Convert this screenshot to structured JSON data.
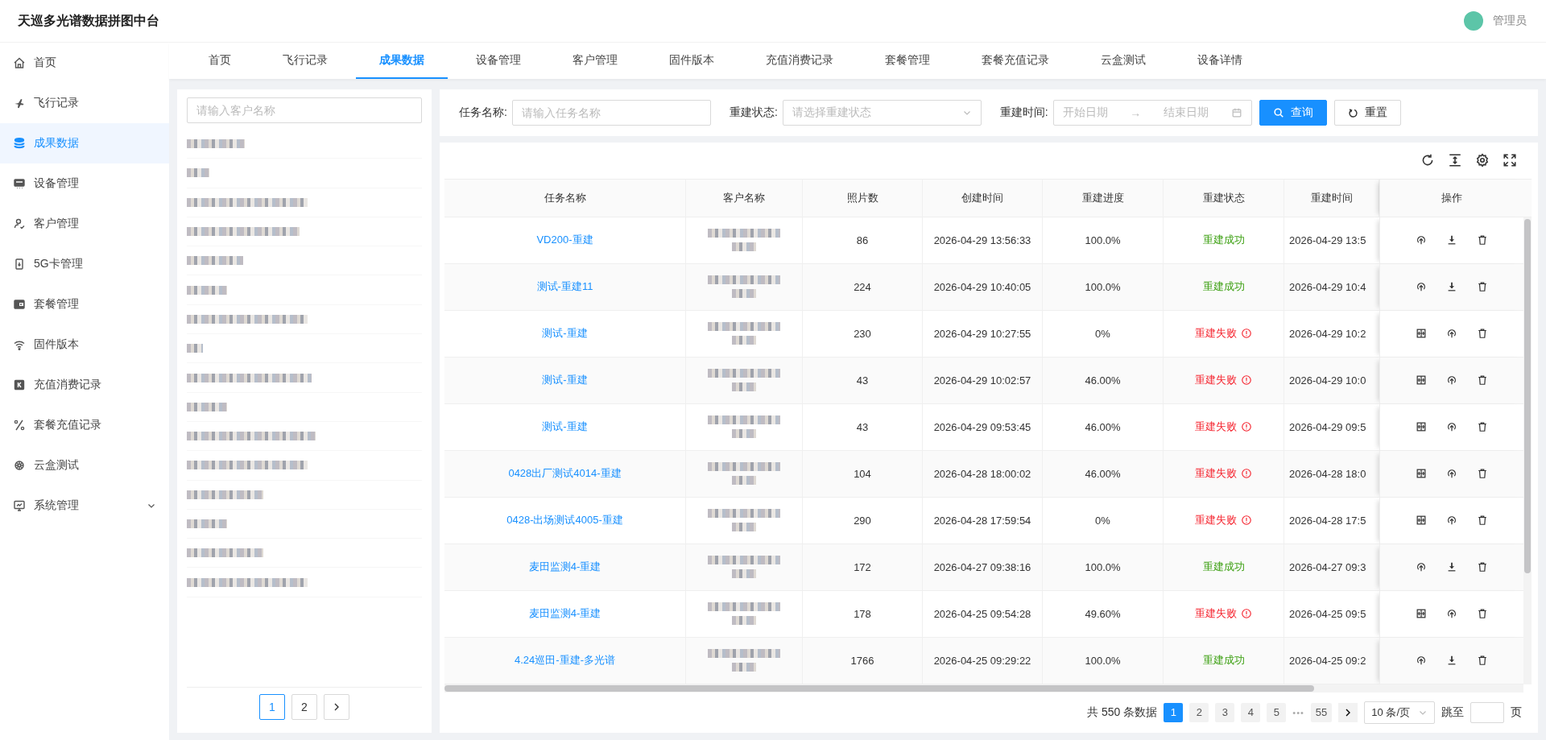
{
  "header": {
    "title": "天巡多光谱数据拼图中台",
    "user": "管理员"
  },
  "sidebar": {
    "items": [
      {
        "label": "首页",
        "kind": "link",
        "selected": false
      },
      {
        "label": "飞行记录",
        "kind": "link",
        "selected": false
      },
      {
        "label": "成果数据",
        "kind": "link",
        "selected": true
      },
      {
        "label": "设备管理",
        "kind": "link",
        "selected": false
      },
      {
        "label": "客户管理",
        "kind": "link",
        "selected": false
      },
      {
        "label": "5G卡管理",
        "kind": "link",
        "selected": false
      },
      {
        "label": "套餐管理",
        "kind": "link",
        "selected": false
      },
      {
        "label": "固件版本",
        "kind": "link",
        "selected": false
      },
      {
        "label": "充值消费记录",
        "kind": "link",
        "selected": false
      },
      {
        "label": "套餐充值记录",
        "kind": "link",
        "selected": false
      },
      {
        "label": "云盒测试",
        "kind": "link",
        "selected": false
      },
      {
        "label": "系统管理",
        "kind": "group",
        "selected": false,
        "expanded": false
      }
    ]
  },
  "tabs": [
    {
      "label": "首页",
      "selected": false
    },
    {
      "label": "飞行记录",
      "selected": false
    },
    {
      "label": "成果数据",
      "selected": true
    },
    {
      "label": "设备管理",
      "selected": false
    },
    {
      "label": "客户管理",
      "selected": false
    },
    {
      "label": "固件版本",
      "selected": false
    },
    {
      "label": "充值消费记录",
      "selected": false
    },
    {
      "label": "套餐管理",
      "selected": false
    },
    {
      "label": "套餐充值记录",
      "selected": false
    },
    {
      "label": "云盒测试",
      "selected": false
    },
    {
      "label": "设备详情",
      "selected": false
    }
  ],
  "customer_panel": {
    "search": {
      "placeholder": "请输入客户名称"
    },
    "pager": {
      "pages": [
        {
          "label": "1",
          "selected": true
        },
        {
          "label": "2",
          "selected": false
        }
      ]
    }
  },
  "filters": {
    "fields": [
      {
        "kind": "input",
        "label": "任务名称:",
        "placeholder": "请输入任务名称"
      },
      {
        "kind": "select",
        "label": "重建状态:",
        "placeholder": "请选择重建状态"
      },
      {
        "kind": "daterange",
        "label": "重建时间:",
        "start_placeholder": "开始日期",
        "separator": "→",
        "end_placeholder": "结束日期"
      }
    ],
    "buttons": [
      {
        "kind": "primary",
        "label": "查询"
      },
      {
        "kind": "default",
        "label": "重置"
      }
    ]
  },
  "table": {
    "columns": [
      "任务名称",
      "客户名称",
      "照片数",
      "创建时间",
      "重建进度",
      "重建状态",
      "重建时间",
      "操作"
    ],
    "rows": [
      {
        "task": "VD200-重建",
        "photos": "86",
        "created": "2026-04-29 13:56:33",
        "progress": "100.0%",
        "status": {
          "kind": "success",
          "label": "重建成功"
        },
        "rebuild_time": "2026-04-29 13:5"
      },
      {
        "task": "测试-重建11",
        "photos": "224",
        "created": "2026-04-29 10:40:05",
        "progress": "100.0%",
        "status": {
          "kind": "success",
          "label": "重建成功"
        },
        "rebuild_time": "2026-04-29 10:4"
      },
      {
        "task": "测试-重建",
        "photos": "230",
        "created": "2026-04-29 10:27:55",
        "progress": "0%",
        "status": {
          "kind": "failed",
          "label": "重建失败"
        },
        "rebuild_time": "2026-04-29 10:2"
      },
      {
        "task": "测试-重建",
        "photos": "43",
        "created": "2026-04-29 10:02:57",
        "progress": "46.00%",
        "status": {
          "kind": "failed",
          "label": "重建失败"
        },
        "rebuild_time": "2026-04-29 10:0"
      },
      {
        "task": "测试-重建",
        "photos": "43",
        "created": "2026-04-29 09:53:45",
        "progress": "46.00%",
        "status": {
          "kind": "failed",
          "label": "重建失败"
        },
        "rebuild_time": "2026-04-29 09:5"
      },
      {
        "task": "0428出厂测试4014-重建",
        "photos": "104",
        "created": "2026-04-28 18:00:02",
        "progress": "46.00%",
        "status": {
          "kind": "failed",
          "label": "重建失败"
        },
        "rebuild_time": "2026-04-28 18:0"
      },
      {
        "task": "0428-出场测试4005-重建",
        "photos": "290",
        "created": "2026-04-28 17:59:54",
        "progress": "0%",
        "status": {
          "kind": "failed",
          "label": "重建失败"
        },
        "rebuild_time": "2026-04-28 17:5"
      },
      {
        "task": "麦田监测4-重建",
        "photos": "172",
        "created": "2026-04-27 09:38:16",
        "progress": "100.0%",
        "status": {
          "kind": "success",
          "label": "重建成功"
        },
        "rebuild_time": "2026-04-27 09:3"
      },
      {
        "task": "麦田监测4-重建",
        "photos": "178",
        "created": "2026-04-25 09:54:28",
        "progress": "49.60%",
        "status": {
          "kind": "failed",
          "label": "重建失败"
        },
        "rebuild_time": "2026-04-25 09:5"
      },
      {
        "task": "4.24巡田-重建-多光谱",
        "photos": "1766",
        "created": "2026-04-25 09:29:22",
        "progress": "100.0%",
        "status": {
          "kind": "success",
          "label": "重建成功"
        },
        "rebuild_time": "2026-04-25 09:2"
      }
    ]
  },
  "pagination": {
    "total": "共 550 条数据",
    "pages": [
      {
        "kind": "page",
        "label": "1",
        "selected": true
      },
      {
        "kind": "page",
        "label": "2",
        "selected": false
      },
      {
        "kind": "page",
        "label": "3",
        "selected": false
      },
      {
        "kind": "page",
        "label": "4",
        "selected": false
      },
      {
        "kind": "page",
        "label": "5",
        "selected": false
      },
      {
        "kind": "ellipsis",
        "label": "•••"
      },
      {
        "kind": "page",
        "label": "55",
        "selected": false
      }
    ],
    "page_size": "10 条/页",
    "jump_label": "跳至",
    "jump_suffix": "页"
  }
}
